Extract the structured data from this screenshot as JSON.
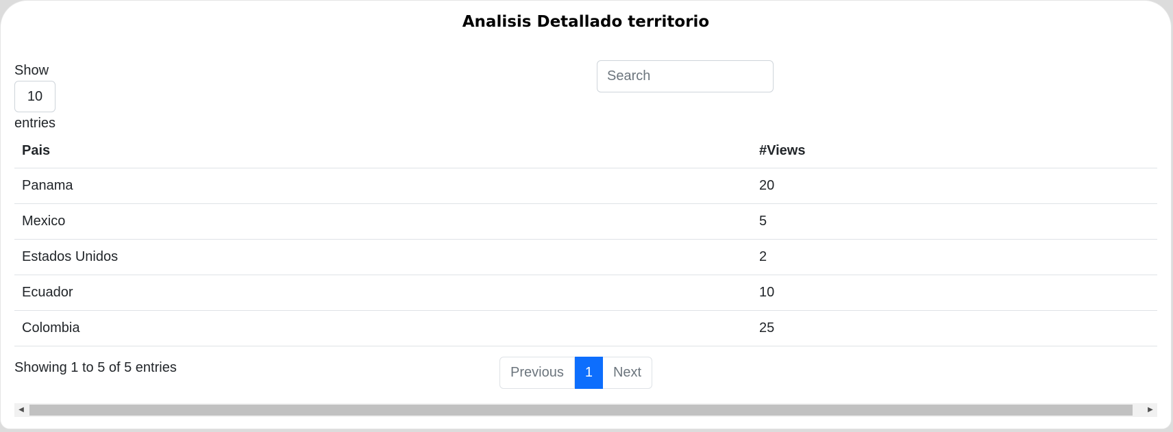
{
  "page": {
    "title": "Analisis Detallado territorio"
  },
  "length_control": {
    "show_label": "Show",
    "selected": "10",
    "entries_label": "entries"
  },
  "search": {
    "placeholder": "Search",
    "value": ""
  },
  "table": {
    "columns": [
      "Pais",
      "#Views"
    ],
    "rows": [
      [
        "Panama",
        "20"
      ],
      [
        "Mexico",
        "5"
      ],
      [
        "Estados Unidos",
        "2"
      ],
      [
        "Ecuador",
        "10"
      ],
      [
        "Colombia",
        "25"
      ]
    ]
  },
  "footer": {
    "info": "Showing 1 to 5 of 5 entries",
    "pagination": {
      "previous": "Previous",
      "current": "1",
      "next": "Next"
    }
  },
  "scrollbar": {
    "left_arrow_icon": "triangle-left",
    "right_arrow_icon": "triangle-right"
  },
  "colors": {
    "accent": "#0d6efd",
    "border": "#dee2e6"
  }
}
